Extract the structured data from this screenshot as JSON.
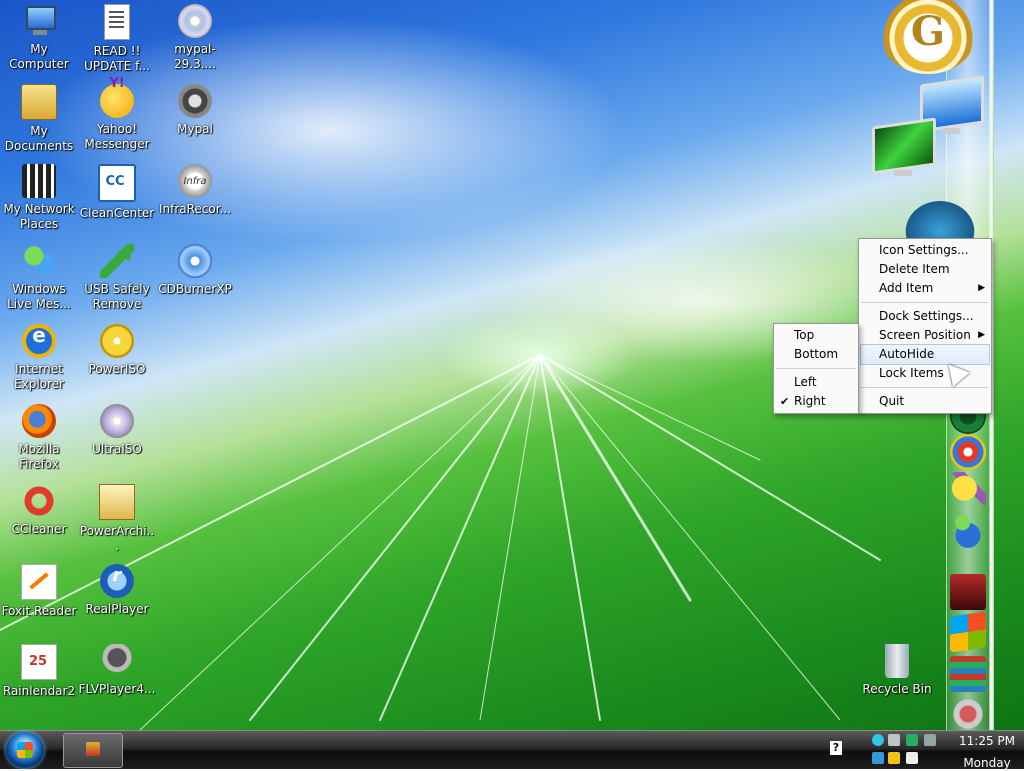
{
  "desktop": {
    "icons": [
      {
        "label": "My Computer",
        "icon": "computer-icon"
      },
      {
        "label": "READ !! UPDATE f...",
        "icon": "text-document-icon"
      },
      {
        "label": "mypal-29.3....",
        "icon": "installer-disc-icon"
      },
      {
        "label": "My Documents",
        "icon": "documents-folder-icon"
      },
      {
        "label": "Yahoo! Messenger",
        "icon": "yahoo-messenger-icon"
      },
      {
        "label": "Mypal",
        "icon": "mypal-raccoon-icon"
      },
      {
        "label": "My Network Places",
        "icon": "network-places-icon"
      },
      {
        "label": "CleanCenter",
        "icon": "cleancenter-icon"
      },
      {
        "label": "InfraRecor...",
        "icon": "infrarecorder-icon"
      },
      {
        "label": "Windows Live Mes...",
        "icon": "windows-live-messenger-icon"
      },
      {
        "label": "USB Safely Remove",
        "icon": "usb-safely-remove-icon"
      },
      {
        "label": "CDBurnerXP",
        "icon": "cdburnerxp-icon"
      },
      {
        "label": "Internet Explorer",
        "icon": "internet-explorer-icon"
      },
      {
        "label": "PowerISO",
        "icon": "poweriso-icon"
      },
      {
        "label": "Mozilla Firefox",
        "icon": "firefox-icon"
      },
      {
        "label": "UltraISO",
        "icon": "ultraiso-icon"
      },
      {
        "label": "CCleaner",
        "icon": "ccleaner-icon"
      },
      {
        "label": "PowerArchi...",
        "icon": "powerarchiver-icon"
      },
      {
        "label": "Foxit Reader",
        "icon": "foxit-reader-icon"
      },
      {
        "label": "RealPlayer",
        "icon": "realplayer-icon"
      },
      {
        "label": "Rainlendar2",
        "icon": "rainlendar-calendar-icon"
      },
      {
        "label": "FLVPlayer4...",
        "icon": "flvplayer-icon"
      },
      {
        "label": "Recycle Bin",
        "icon": "recycle-bin-icon"
      }
    ]
  },
  "context_menu": {
    "items": {
      "icon_settings": "Icon Settings...",
      "delete_item": "Delete Item",
      "add_item": "Add Item",
      "dock_settings": "Dock Settings...",
      "screen_position": "Screen Position",
      "autohide": "AutoHide",
      "lock_items": "Lock Items",
      "quit": "Quit"
    },
    "highlighted": "AutoHide"
  },
  "screen_position_menu": {
    "top": "Top",
    "bottom": "Bottom",
    "left": "Left",
    "right": "Right",
    "checked": "Right"
  },
  "taskbar": {
    "help_glyph": "?",
    "clock_time": "11:25 PM",
    "clock_day": "Monday"
  },
  "colors": {
    "taskbar": "#1f1f1f",
    "menu_highlight": "#e0ecfa",
    "wallpaper_green": "#2fa528",
    "wallpaper_blue": "#2f78de"
  }
}
